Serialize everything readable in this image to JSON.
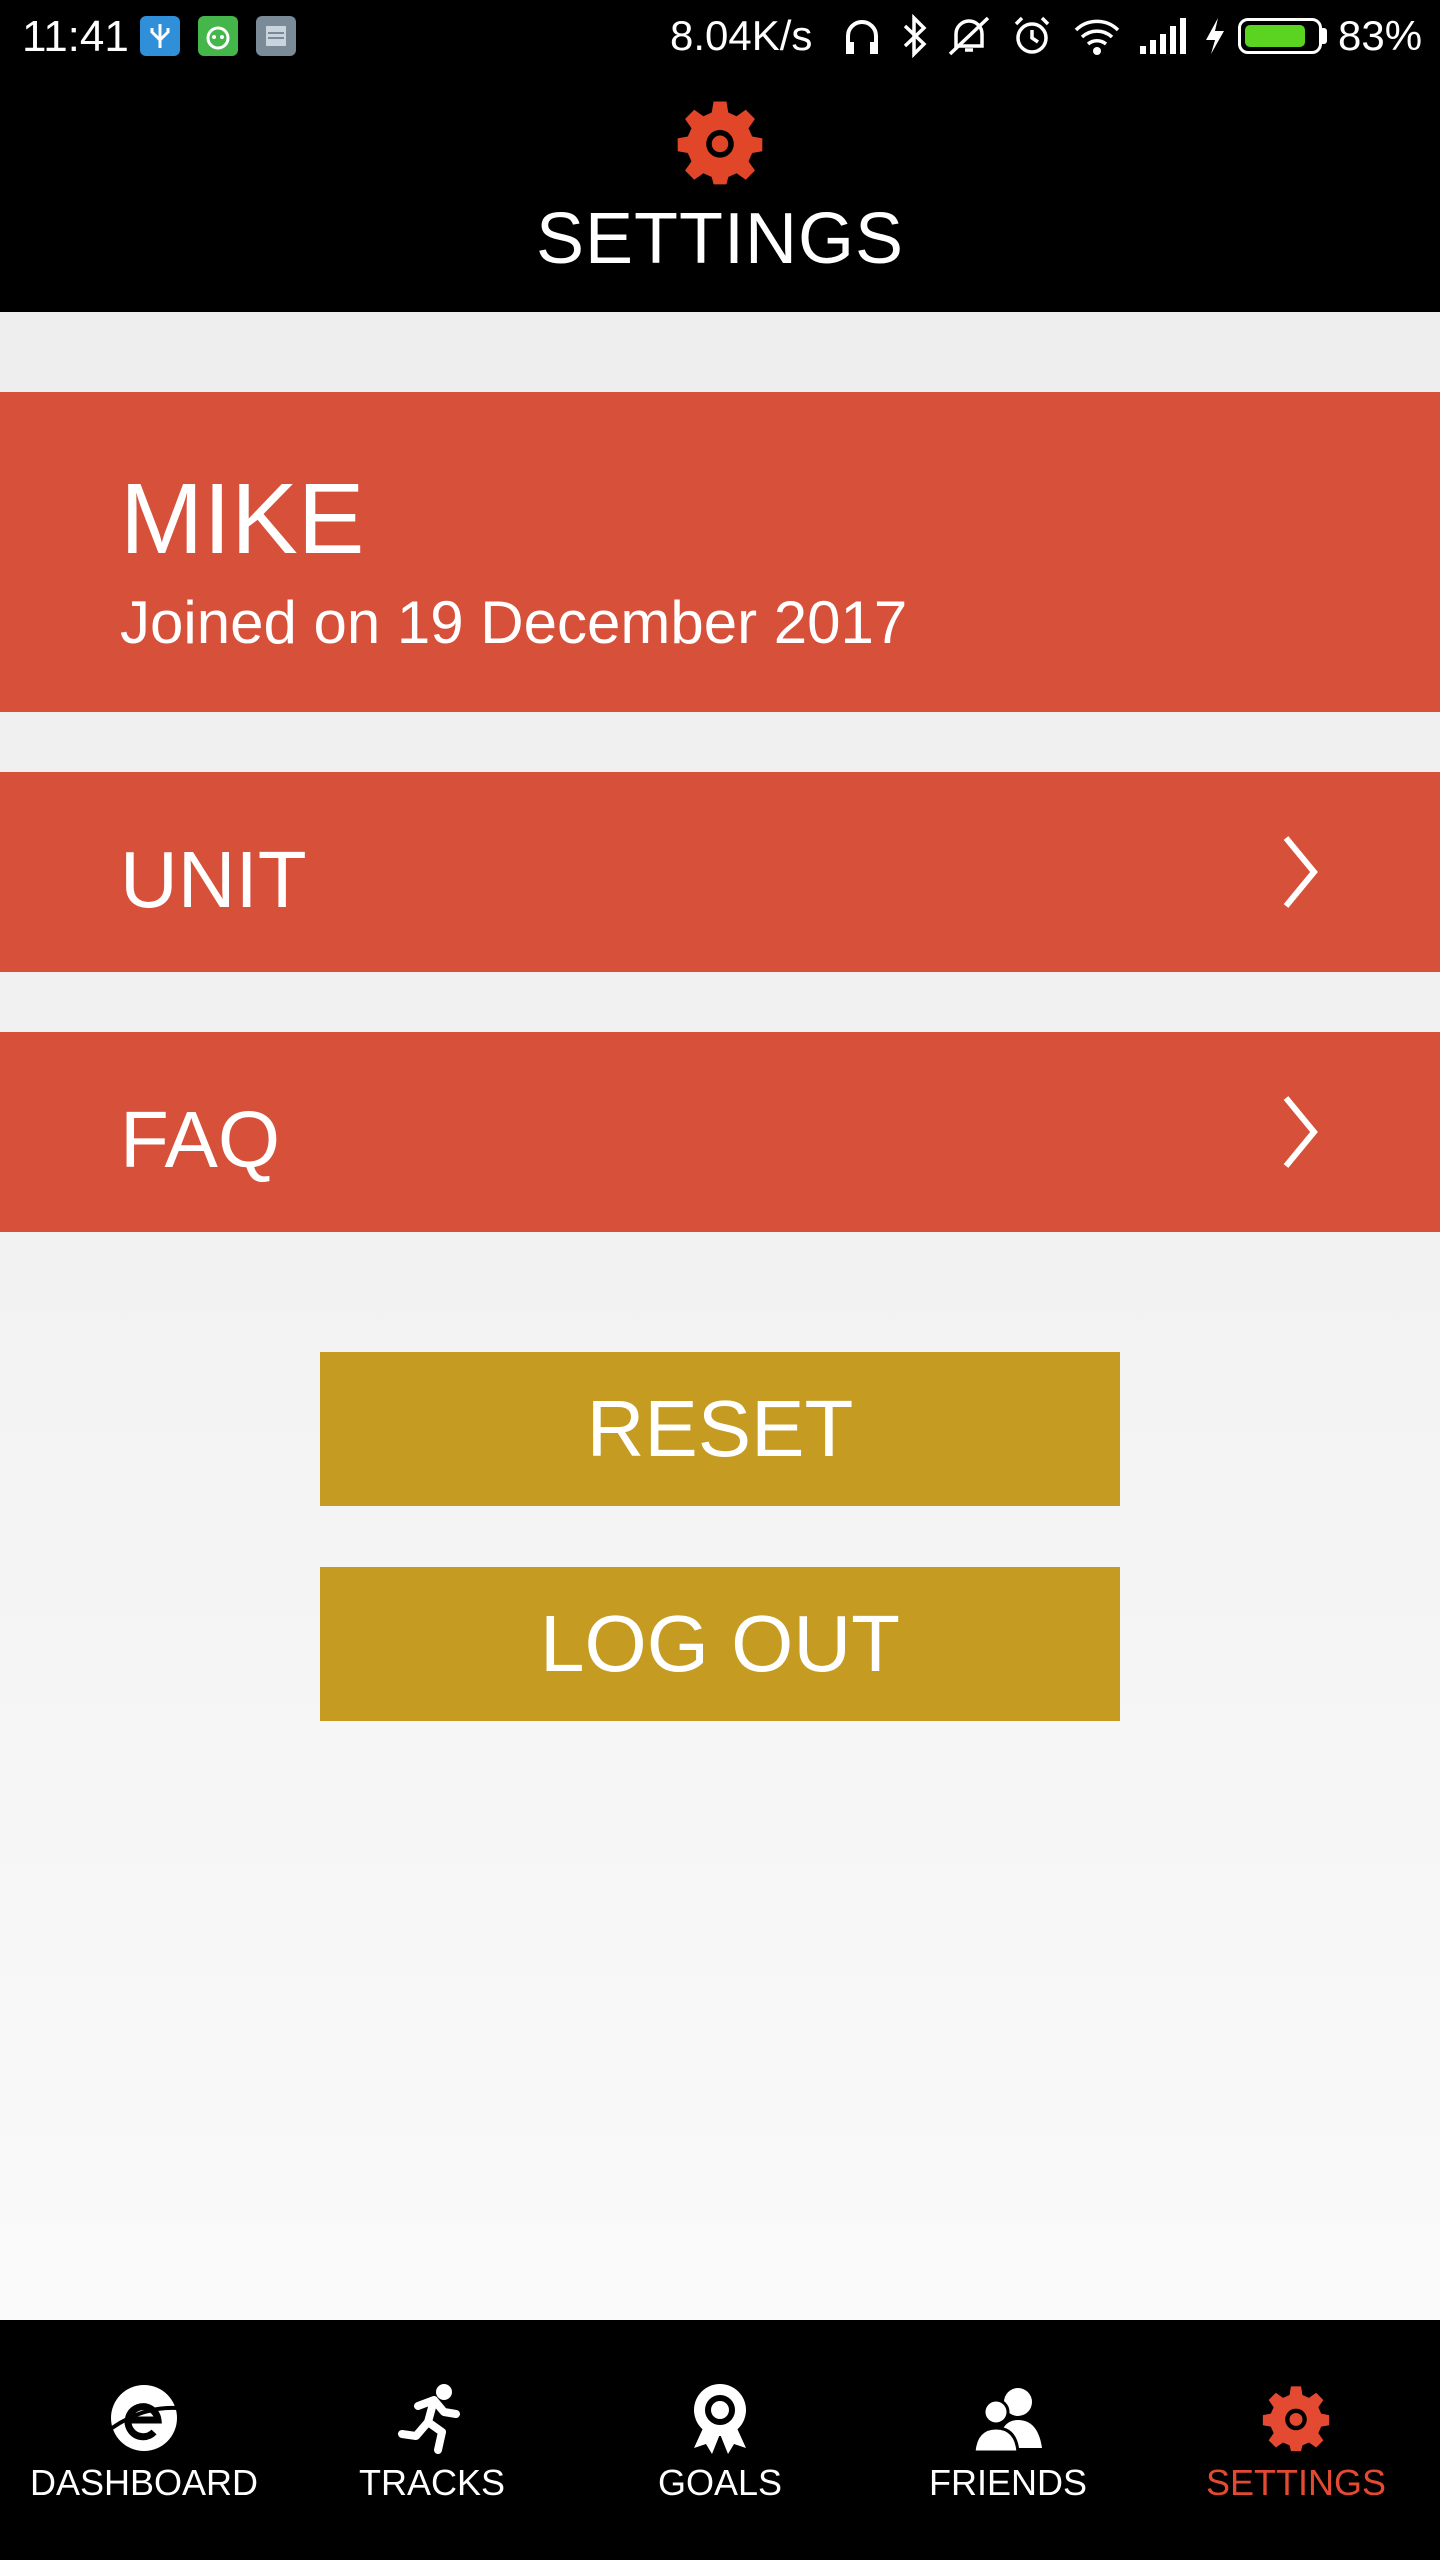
{
  "status_bar": {
    "time": "11:41",
    "net_speed": "8.04K/s",
    "battery_percent": "83%",
    "battery_level": 0.83,
    "icons": [
      "usb-icon",
      "android-icon",
      "notes-icon",
      "headphones-icon",
      "bluetooth-icon",
      "mute-icon",
      "alarm-icon",
      "wifi-icon",
      "signal-icon",
      "charging-icon",
      "battery-icon"
    ]
  },
  "header": {
    "title": "SETTINGS",
    "icon": "gear-icon"
  },
  "profile": {
    "name": "MIKE",
    "joined": "Joined on 19 December 2017"
  },
  "menu": [
    {
      "label": "UNIT",
      "icon": "chevron-right-icon"
    },
    {
      "label": "FAQ",
      "icon": "chevron-right-icon"
    }
  ],
  "buttons": {
    "reset": "RESET",
    "logout": "LOG OUT"
  },
  "colors": {
    "accent_red": "#d6503a",
    "button_gold": "#c59b22",
    "active_tab": "#e44a32"
  },
  "nav": [
    {
      "label": "DASHBOARD",
      "icon": "dashboard-icon",
      "active": false
    },
    {
      "label": "TRACKS",
      "icon": "runner-icon",
      "active": false
    },
    {
      "label": "GOALS",
      "icon": "medal-icon",
      "active": false
    },
    {
      "label": "FRIENDS",
      "icon": "friends-icon",
      "active": false
    },
    {
      "label": "SETTINGS",
      "icon": "gear-icon",
      "active": true
    }
  ]
}
